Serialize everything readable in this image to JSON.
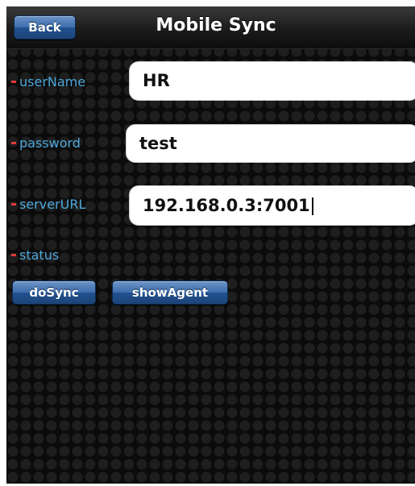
{
  "header": {
    "title": "Mobile Sync",
    "back_label": "Back"
  },
  "form": {
    "username": {
      "label": "userName",
      "value": "HR"
    },
    "password": {
      "label": "password",
      "value": "test"
    },
    "server_url": {
      "label": "serverURL",
      "value": "192.168.0.3:7001"
    },
    "status": {
      "label": "status"
    }
  },
  "actions": {
    "do_sync_label": "doSync",
    "show_agent_label": "showAgent"
  },
  "colors": {
    "label": "#4ca7d9",
    "required_marker": "#e23b3b",
    "button_blue": "#3c6cab"
  }
}
